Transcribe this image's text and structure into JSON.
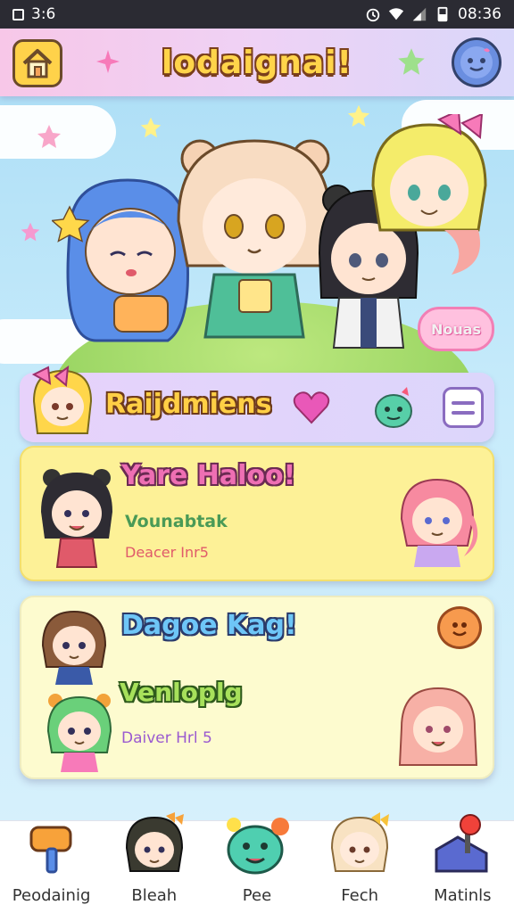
{
  "status_bar": {
    "time_left": "3:6",
    "time_right": "08:36"
  },
  "header": {
    "title": "lodaignai!",
    "home_icon": "home-icon",
    "profile_icon": "profile-avatar-icon"
  },
  "hero": {
    "bubble_label": "Nouas"
  },
  "featured": {
    "title": "Raijdmiens"
  },
  "cards": [
    {
      "title": "Yare Haloo!",
      "subtitle": "Vounabtak",
      "meta": "Deacer Inr5"
    },
    {
      "title": "Dagoe Kag!",
      "subtitle": "Venloplg",
      "meta": "Daiver Hrl 5"
    }
  ],
  "bottom_nav": [
    {
      "label": "Peodainig",
      "icon": "hammer-icon"
    },
    {
      "label": "Bleah",
      "icon": "character-icon"
    },
    {
      "label": "Pee",
      "icon": "monster-icon"
    },
    {
      "label": "Fech",
      "icon": "character-icon"
    },
    {
      "label": "Matinls",
      "icon": "joystick-icon"
    }
  ],
  "colors": {
    "header_bg": "#efd2f5",
    "card1_bg": "#fdf197",
    "card2_bg": "#fdfbcf",
    "sky": "#a8dcf5"
  }
}
